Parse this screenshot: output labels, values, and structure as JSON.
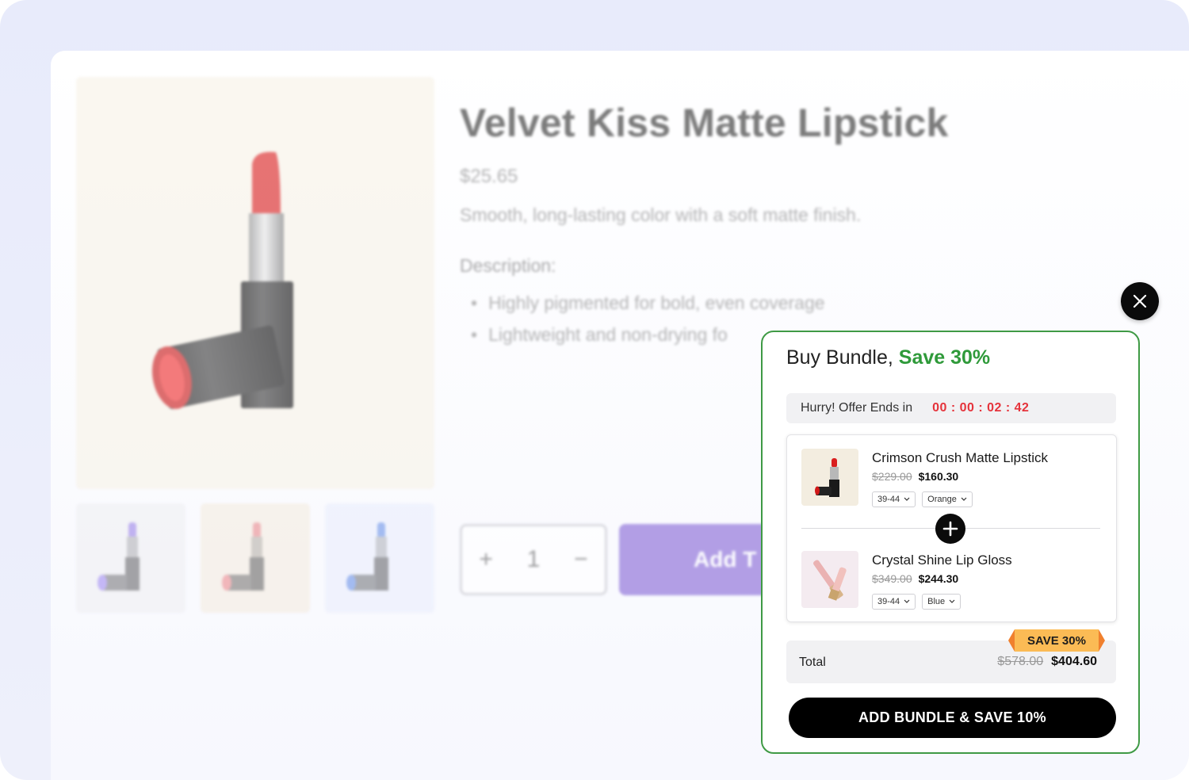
{
  "product": {
    "title": "Velvet Kiss Matte Lipstick",
    "price": "$25.65",
    "tagline": "Smooth, long-lasting color with a soft matte finish.",
    "description_heading": "Description:",
    "bullets": [
      "Highly pigmented for bold, even coverage",
      "Lightweight and non-drying fo"
    ],
    "quantity": {
      "plus": "+",
      "value": "1",
      "minus": "−"
    },
    "add_to_cart_label": "Add T"
  },
  "bundle": {
    "title_prefix": "Buy Bundle, ",
    "title_save": "Save 30%",
    "timer_label": "Hurry! Offer Ends in",
    "timer_value": "00 : 00 : 02 : 42",
    "items": [
      {
        "name": "Crimson Crush Matte Lipstick",
        "old_price": "$229.00",
        "new_price": "$160.30",
        "size": "39-44",
        "color": "Orange"
      },
      {
        "name": "Crystal Shine Lip Gloss",
        "old_price": "$349.00",
        "new_price": "$244.30",
        "size": "39-44",
        "color": "Blue"
      }
    ],
    "save_badge": "SAVE 30%",
    "total_label": "Total",
    "total_old": "$578.00",
    "total_new": "$404.60",
    "cta": "ADD BUNDLE & SAVE 10%"
  },
  "colors": {
    "accent_green": "#2f9a3a",
    "timer_red": "#e5333b",
    "cta_purple": "#8667d6",
    "ribbon": "#fbbb55"
  }
}
